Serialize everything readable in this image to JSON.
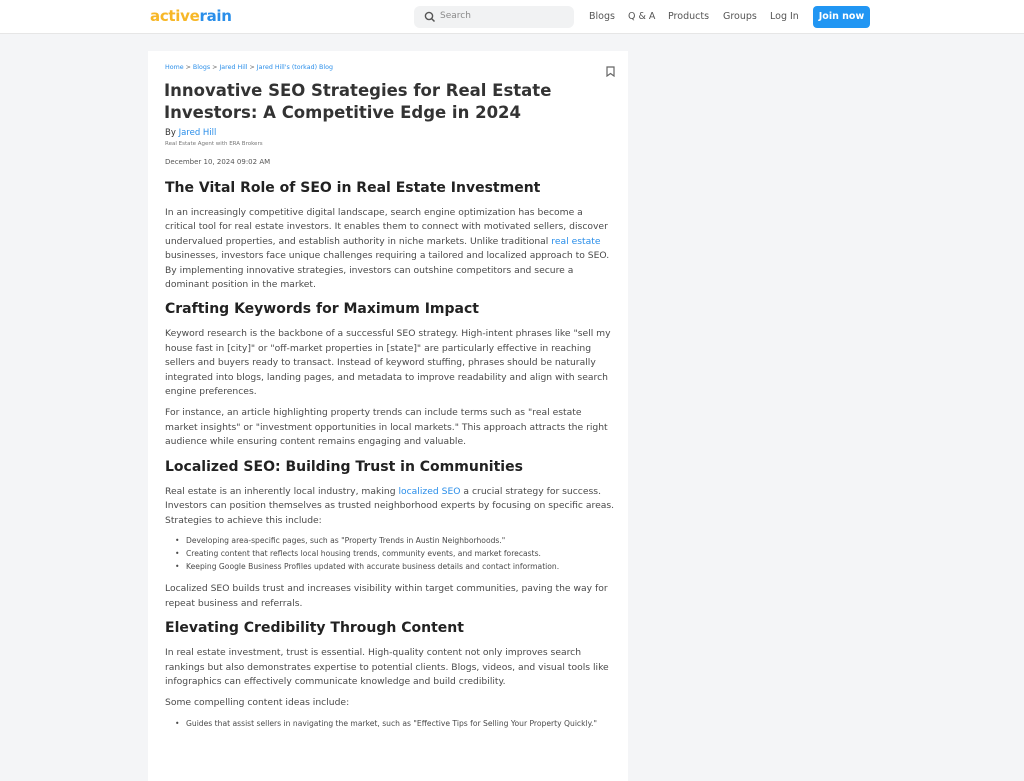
{
  "header": {
    "logo": {
      "part1": "active",
      "part2": "rain"
    },
    "search": {
      "placeholder": "Search",
      "icon": "search-icon"
    },
    "nav": [
      "Blogs",
      "Q & A",
      "Products",
      "Groups",
      "Log In"
    ],
    "join_label": "Join now",
    "accent_color": "#2196f3"
  },
  "article": {
    "breadcrumb": [
      "Home",
      "Blogs",
      "Jared Hill",
      "Jared Hill's (torkad) Blog"
    ],
    "breadcrumb_sep": ">",
    "bookmark_icon": "bookmark-icon",
    "title": "Innovative SEO Strategies for Real Estate Investors: A Competitive Edge in 2024",
    "by_label": "By",
    "author": "Jared Hill",
    "author_role": "Real Estate Agent with ERA Brokers",
    "date": "December 10, 2024 09:02 AM",
    "sections": [
      {
        "heading": "The Vital Role of SEO in Real Estate Investment",
        "p1_a": "In an increasingly competitive digital landscape, search engine optimization has become a critical tool for real estate investors. It enables them to connect with motivated sellers, discover undervalued properties, and establish authority in niche markets. Unlike traditional ",
        "p1_link": "real estate",
        "p1_b": " businesses, investors face unique challenges requiring a tailored and localized approach to SEO. By implementing innovative strategies, investors can outshine competitors and secure a dominant position in the market."
      },
      {
        "heading": "Crafting Keywords for Maximum Impact",
        "p1": "Keyword research is the backbone of a successful SEO strategy. High-intent phrases like \"sell my house fast in [city]\" or \"off-market properties in [state]\" are particularly effective in reaching sellers and buyers ready to transact. Instead of keyword stuffing, phrases should be naturally integrated into blogs, landing pages, and metadata to improve readability and align with search engine preferences.",
        "p2": "For instance, an article highlighting property trends can include terms such as \"real estate market insights\" or \"investment opportunities in local markets.\" This approach attracts the right audience while ensuring content remains engaging and valuable."
      },
      {
        "heading": "Localized SEO: Building Trust in Communities",
        "p1_a": "Real estate is an inherently local industry, making ",
        "p1_link": "localized SEO",
        "p1_b": " a crucial strategy for success. Investors can position themselves as trusted neighborhood experts by focusing on specific areas. Strategies to achieve this include:",
        "bullets": [
          "Developing area-specific pages, such as \"Property Trends in Austin Neighborhoods.\"",
          "Creating content that reflects local housing trends, community events, and market forecasts.",
          "Keeping Google Business Profiles updated with accurate business details and contact information."
        ],
        "p2": "Localized SEO builds trust and increases visibility within target communities, paving the way for repeat business and referrals."
      },
      {
        "heading": "Elevating Credibility Through Content",
        "p1": "In real estate investment, trust is essential. High-quality content not only improves search rankings but also demonstrates expertise to potential clients. Blogs, videos, and visual tools like infographics can effectively communicate knowledge and build credibility.",
        "p2": "Some compelling content ideas include:",
        "bullets": [
          "Guides that assist sellers in navigating the market, such as \"Effective Tips for Selling Your Property Quickly.\""
        ]
      }
    ]
  }
}
